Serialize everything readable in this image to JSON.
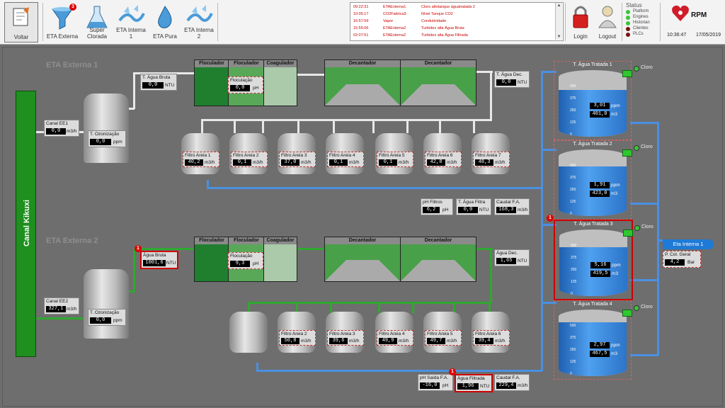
{
  "toolbar": {
    "back_label": "Voltar",
    "tabs": [
      {
        "label": "ETA Externa",
        "badge": "3"
      },
      {
        "label": "Super Clorada"
      },
      {
        "label": "ETA Interna 1"
      },
      {
        "label": "ETA Pura"
      },
      {
        "label": "ETA Interna 2"
      }
    ],
    "login_label": "Login",
    "logout_label": "Logout",
    "status": {
      "title": "Status",
      "items": [
        {
          "label": "Platform",
          "color": "#39c639"
        },
        {
          "label": "Engines",
          "color": "#39c639"
        },
        {
          "label": "Historian",
          "color": "#39c639"
        },
        {
          "label": "Clientes",
          "color": "#7a1010"
        },
        {
          "label": "PLCs",
          "color": "#7a1010"
        }
      ]
    },
    "brand": "RPM",
    "time": "10:36:47",
    "date": "17/05/2019"
  },
  "alarms": [
    {
      "time": "09:22:31",
      "src": "ETAExterna1",
      "msg": "Cloro altotanque águatratada 2"
    },
    {
      "time": "10:05:17",
      "src": "CO2Fabrica3",
      "msg": "Nível Tanque CO2"
    },
    {
      "time": "16:57:59",
      "src": "Vapor",
      "msg": "Condutividade"
    },
    {
      "time": "15:55:06",
      "src": "ETAExterna2",
      "msg": "Turbidez alta Água Bruta"
    },
    {
      "time": "02:07:51",
      "src": "ETAExterna2",
      "msg": "Turbidez alta Água Filtrada"
    }
  ],
  "canal": {
    "label": "Canal Kikuxi"
  },
  "eta1": {
    "title": "ETA Externa 1",
    "canal_ee": {
      "label": "Canal EE1",
      "value": "0,0",
      "unit": "m3/h"
    },
    "ozon": {
      "label": "T. Ozonização",
      "value": "0,0",
      "unit": "ppm"
    },
    "agua_bruta": {
      "label": "T. Água Bruta",
      "value": "0,0",
      "unit": "NTU"
    },
    "floc_label": "Floculador",
    "coag_label": "Coagulador",
    "decant_label": "Decantador",
    "floculacao": {
      "label": "Floculação",
      "value": "0,0",
      "unit": "pH"
    },
    "agua_dec": {
      "label": "T. Água Dec.",
      "value": "0,0",
      "unit": "NTU"
    },
    "filtros": [
      {
        "label": "Filtro Areia 1",
        "value": "40,2",
        "unit": "m3/h"
      },
      {
        "label": "Filtro Areia 2",
        "value": "0,1",
        "unit": "m3/h"
      },
      {
        "label": "Filtro Areia 3",
        "value": "37,0",
        "unit": "m3/h"
      },
      {
        "label": "Filtro Areia 4",
        "value": "0,1",
        "unit": "m3/h"
      },
      {
        "label": "Filtro Areia 5",
        "value": "0,1",
        "unit": "m3/h"
      },
      {
        "label": "Filtro Areia 6",
        "value": "42,8",
        "unit": "m3/h"
      },
      {
        "label": "Filtro Areia 7",
        "value": "48,3",
        "unit": "m3/h"
      }
    ],
    "ph_filtros": {
      "label": "pH Filtros",
      "value": "6,2",
      "unit": "pH"
    },
    "agua_filtra": {
      "label": "T. Água Filtra",
      "value": "0,0",
      "unit": "NTU"
    },
    "caudal": {
      "label": "Caudal F.A.",
      "value": "168,3",
      "unit": "m3/h"
    }
  },
  "eta2": {
    "title": "ETA Externa 2",
    "canal_ee": {
      "label": "Canal EE2",
      "value": "327,1",
      "unit": "m3/h"
    },
    "ozon": {
      "label": "T. Ozonização",
      "value": "0,0",
      "unit": "ppm"
    },
    "agua_bruta": {
      "label": "Água Bruta",
      "value": "1001,6",
      "unit": "NTU"
    },
    "floc_label": "Floculador",
    "coag_label": "Coagulador",
    "decant_label": "Decantador",
    "floculacao": {
      "label": "Floculação",
      "value": "9,3",
      "unit": "pH"
    },
    "agua_dec": {
      "label": "Água Dec.",
      "value": "1,65",
      "unit": "NTU"
    },
    "filtros": [
      {
        "label": "Filtro Areia 2",
        "value": "50,8",
        "unit": "m3/h"
      },
      {
        "label": "Filtro Areia 3",
        "value": "39,6",
        "unit": "m3/h"
      },
      {
        "label": "Filtro Areia 4",
        "value": "49,9",
        "unit": "m3/h"
      },
      {
        "label": "Filtro Areia 5",
        "value": "49,7",
        "unit": "m3/h"
      },
      {
        "label": "Filtro Areia 6",
        "value": "39,4",
        "unit": "m3/h"
      }
    ],
    "ph_saida": {
      "label": "pH Saída F.A.",
      "value": "-16,0",
      "unit": "pH"
    },
    "agua_filtrada": {
      "label": "Água Filtrada",
      "value": "1,96",
      "unit": "NTU"
    },
    "caudal": {
      "label": "Caudal F.A.",
      "value": "229,4",
      "unit": "m3/h"
    }
  },
  "tanques": [
    {
      "title": "T. Água Tratada 1",
      "cloro_label": "Cloro",
      "ppm": "3,01",
      "ppm_unit": "ppm",
      "m3": "401,0",
      "m3_unit": "m3",
      "level": 0.8
    },
    {
      "title": "T. Água Tratada 2",
      "cloro_label": "Cloro",
      "ppm": "1,91",
      "ppm_unit": "ppm",
      "m3": "423,0",
      "m3_unit": "m3",
      "level": 0.85
    },
    {
      "title": "T. Água Tratada 3",
      "cloro_label": "Cloro",
      "ppm": "5,16",
      "ppm_unit": "ppm",
      "m3": "419,5",
      "m3_unit": "m3",
      "level": 0.84
    },
    {
      "title": "T. Água Tratada 4",
      "cloro_label": "Cloro",
      "ppm": "2,97",
      "ppm_unit": "ppm",
      "m3": "467,5",
      "m3_unit": "m3",
      "level": 0.93
    }
  ],
  "scale_ticks": [
    "500",
    "375",
    "250",
    "125",
    "0"
  ],
  "eta_interna": {
    "label": "Eta Interna 1"
  },
  "p_col": {
    "label": "P. Col. Geral",
    "value": "4,2",
    "unit": "Bar"
  },
  "badge_one": "1"
}
